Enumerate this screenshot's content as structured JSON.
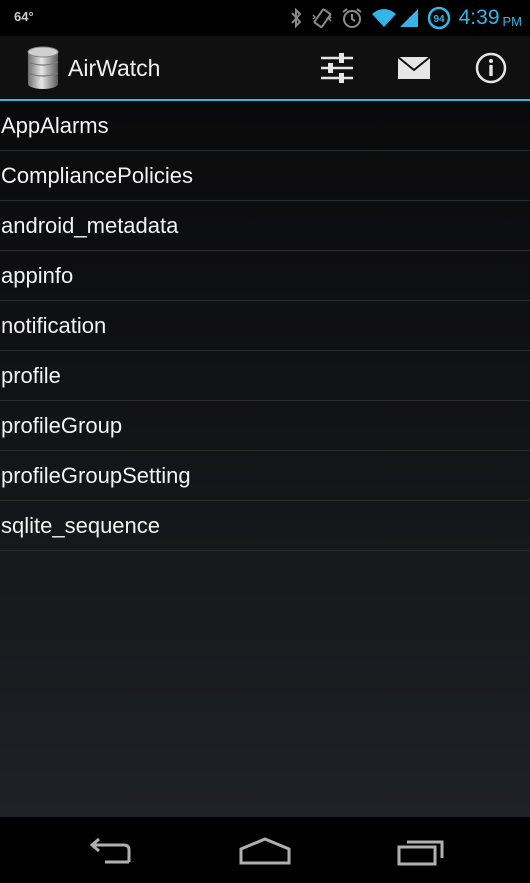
{
  "status_bar": {
    "temperature": "64°",
    "battery_level": "94",
    "time": "4:39",
    "ampm": "PM",
    "icons": [
      "bluetooth-icon",
      "vibrate-icon",
      "alarm-icon",
      "wifi-icon",
      "signal-icon",
      "battery-icon"
    ]
  },
  "action_bar": {
    "title": "AirWatch",
    "app_icon": "database-icon",
    "actions": [
      "settings-sliders-icon",
      "mail-icon",
      "info-icon"
    ]
  },
  "tables": [
    "AppAlarms",
    "CompliancePolicies",
    "android_metadata",
    "appinfo",
    "notification",
    "profile",
    "profileGroup",
    "profileGroupSetting",
    "sqlite_sequence"
  ],
  "nav_bar": {
    "buttons": [
      "back-icon",
      "home-icon",
      "recent-apps-icon"
    ]
  },
  "colors": {
    "accent": "#33b5e5",
    "action_bar_bg": "#101010",
    "list_text": "#f2f2f2",
    "divider": "#2c2c2c"
  }
}
